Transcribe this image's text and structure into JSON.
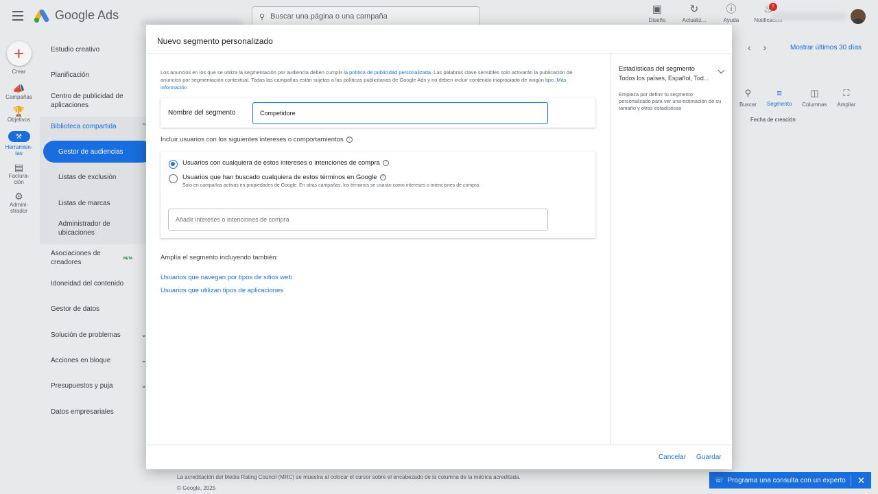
{
  "app": {
    "logo_text": "Google Ads",
    "search_placeholder": "Buscar una página o una campaña",
    "top_icons": [
      {
        "label": "Diseño",
        "icon": "layout-icon"
      },
      {
        "label": "Actualiz...",
        "icon": "refresh-icon"
      },
      {
        "label": "Ayuda",
        "icon": "help-icon"
      },
      {
        "label": "Notificación",
        "icon": "bell-icon",
        "badge": "!"
      }
    ]
  },
  "rail": {
    "create": "Crear",
    "items": [
      "Campañas",
      "Objetivos",
      "Herramien-\ntas",
      "Factura-\nción",
      "Admini-\nstrador"
    ]
  },
  "sidenav": {
    "items": [
      "Estudio creativo",
      "Planificación",
      "Centro de publicidad de aplicaciones",
      "Biblioteca compartida",
      "Gestor de audiencias",
      "Listas de exclusión",
      "Listas de marcas",
      "Administrador de ubicaciones",
      "Asociaciones de creadores",
      "Idoneidad del contenido",
      "Gestor de datos",
      "Solución de problemas",
      "Acciones en bloque",
      "Presupuestos y puja",
      "Datos empresariales"
    ],
    "beta": "BETA"
  },
  "toolbar": {
    "period": "Mostrar últimos 30 días",
    "tools": [
      "Buscar",
      "Segmento",
      "Columnas",
      "Ampliar"
    ],
    "column_header": "Fecha de creación"
  },
  "footer": {
    "line1": "La acreditación del Media Rating Council (MRC) se muestra al colocar el cursor sobre el encabezado de la columna de la métrica acreditada.",
    "line2": "© Google, 2025",
    "consult": "Programa una consulta con un experto"
  },
  "dialog": {
    "title": "Nuevo segmento personalizado",
    "policy_text_1": "Los anuncios en los que se utiliza la segmentación por audiencia deben cumplir la ",
    "policy_link": "política de publicidad personalizada",
    "policy_text_2": ". Las palabras clave sensibles solo activarán la publicación de anuncios por segmentación contextual. Todas las campañas están sujetas a las políticas publicitarias de Google Ads y no deben incluir contenido inapropiado de ningún tipo. ",
    "more_info": "Más información",
    "name_label": "Nombre del segmento",
    "name_value": "Competidore",
    "include_label": "Incluir usuarios con los siguientes intereses o comportamientos",
    "option_1": "Usuarios con cualquiera de estos intereses o intenciones de compra",
    "option_2": "Usuarios que han buscado cualquiera de estos términos en Google",
    "option_2_sub": "Solo en campañas activas en propiedades de Google. En otras campañas, los términos se usarán como intereses o intenciones de compra.",
    "add_placeholder": "Añadir intereses o intenciones de compra",
    "expand_label": "Amplía el segmento incluyendo también:",
    "link_1": "Usuarios que navegan por tipos de sitios web",
    "link_2": "Usuarios que utilizan tipos de aplicaciones",
    "stats_title": "Estadísticas del segmento",
    "stats_sub": "Todos los países, Español, Tod...",
    "stats_desc": "Empieza por definir tu segmento personalizado para ver una estimación de su tamaño y otras estadísticas",
    "cancel": "Cancelar",
    "save": "Guardar"
  },
  "colors": {
    "accent": "#1a73e8"
  }
}
